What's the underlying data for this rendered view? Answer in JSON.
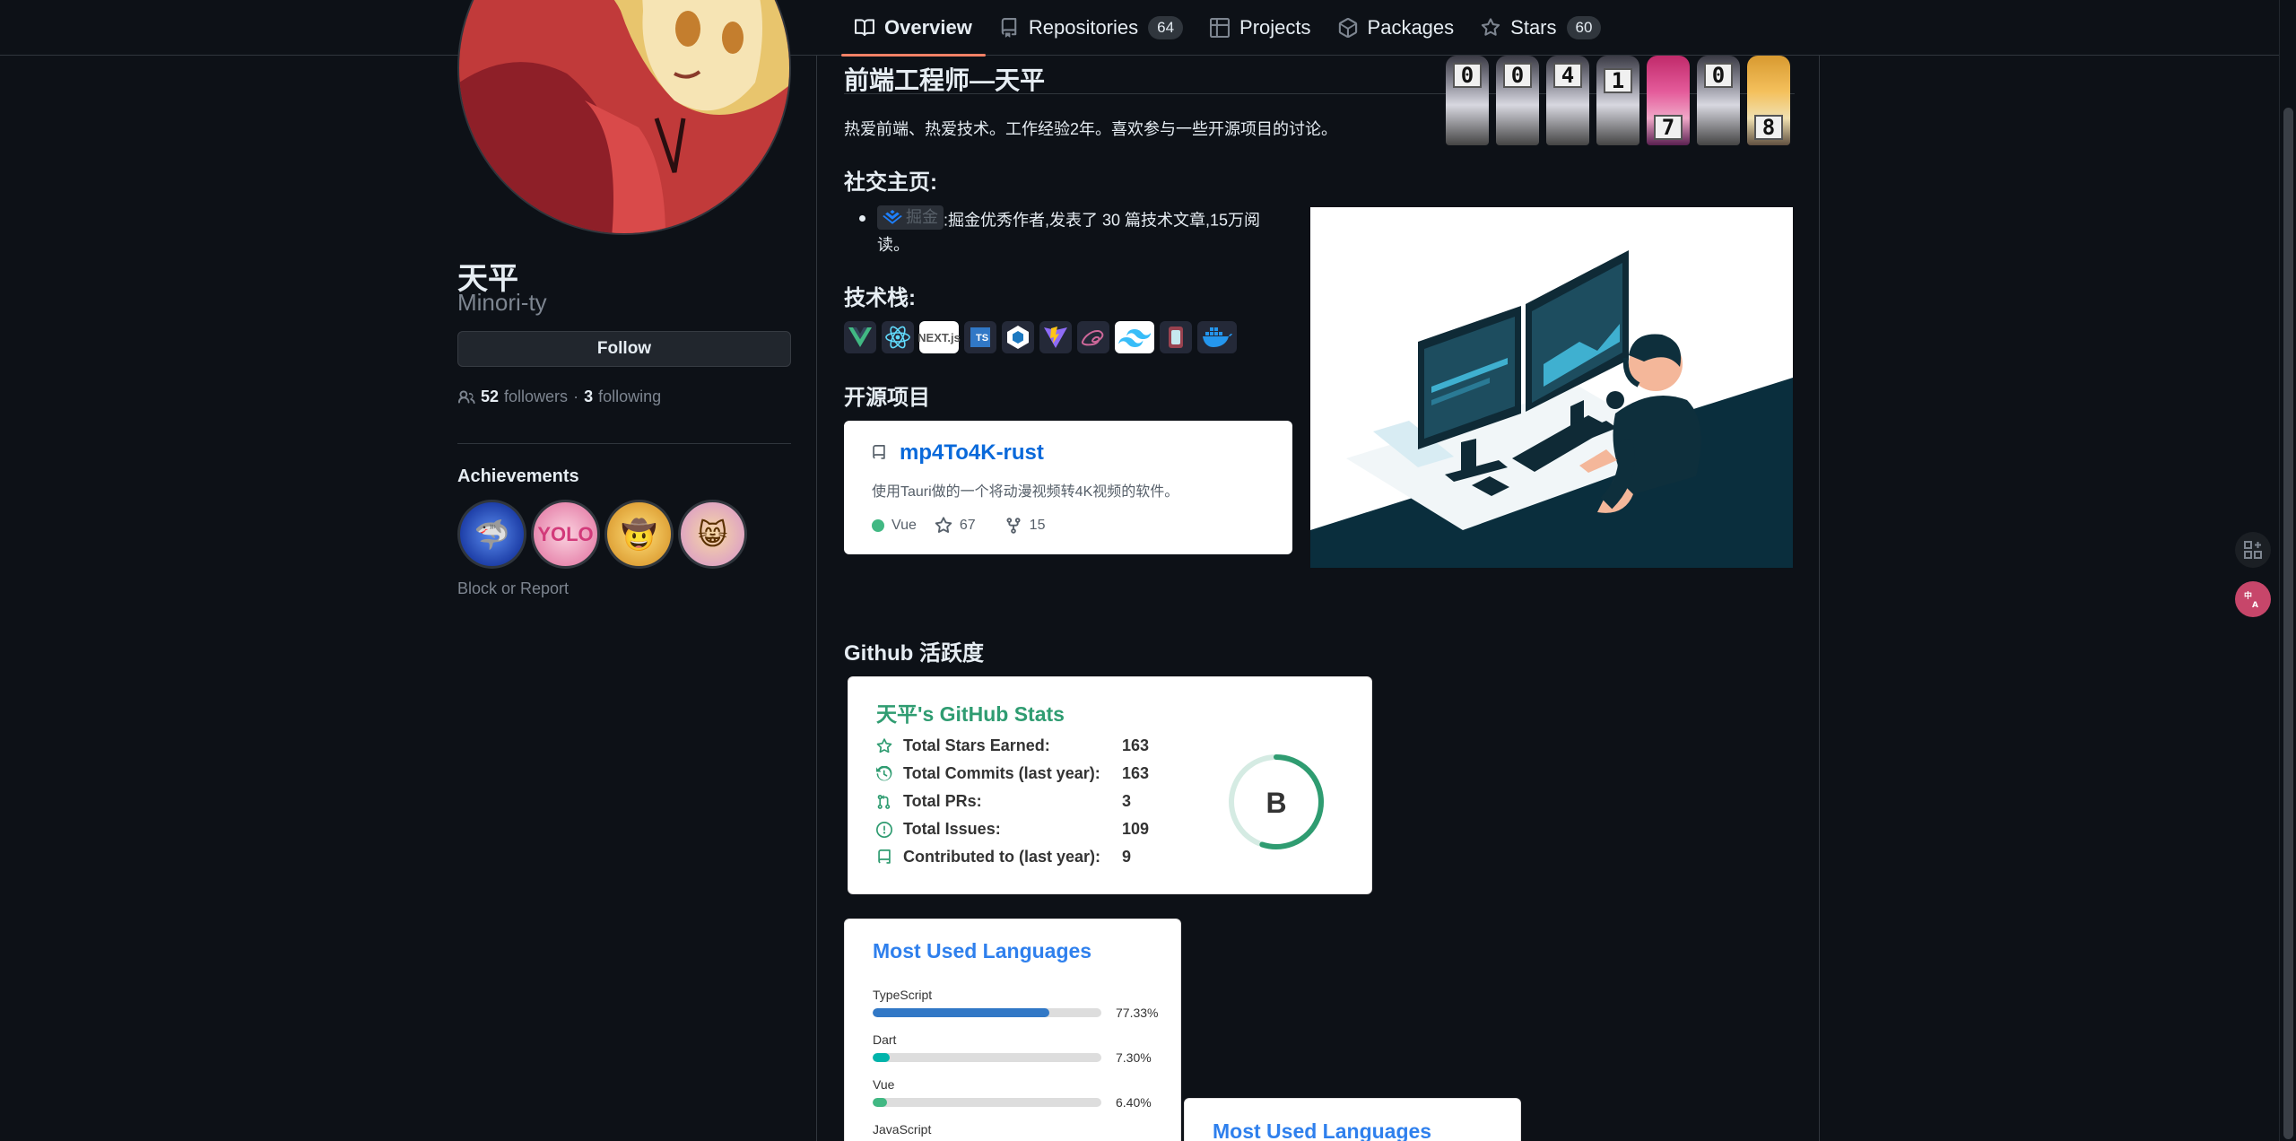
{
  "nav": {
    "tabs": [
      {
        "label": "Overview"
      },
      {
        "label": "Repositories",
        "count": "64"
      },
      {
        "label": "Projects"
      },
      {
        "label": "Packages"
      },
      {
        "label": "Stars",
        "count": "60"
      }
    ]
  },
  "profile": {
    "name": "天平",
    "login": "Minori-ty",
    "follow_label": "Follow",
    "followers_count": "52",
    "followers_label": "followers",
    "following_count": "3",
    "following_label": "following",
    "achievements_title": "Achievements",
    "block_label": "Block or Report"
  },
  "readme": {
    "title": "前端工程师—天平",
    "visitor_digits": [
      "0",
      "0",
      "4",
      "1",
      "7",
      "0",
      "8"
    ],
    "intro": "热爱前端、热爱技术。工作经验2年。喜欢参与一些开源项目的讨论。",
    "social_heading": "社交主页:",
    "juejin_label": "掘金",
    "social_text": ":掘金优秀作者,发表了 30 篇技术文章,15万阅读。",
    "stack_heading": "技术栈:",
    "stack_icons": [
      "vue-icon",
      "react-icon",
      "nextjs-icon",
      "typescript-icon",
      "webpack-icon",
      "vite-icon",
      "sass-icon",
      "tailwind-icon",
      "jest-icon",
      "docker-icon"
    ],
    "nextjs_label": "NEXT.js",
    "ts_label": "TS",
    "opensource_heading": "开源项目",
    "activity_heading": "Github 活跃度"
  },
  "repo": {
    "name": "mp4To4K-rust",
    "description": "使用Tauri做的一个将动漫视频转4K视频的软件。",
    "language": "Vue",
    "language_color": "#41b883",
    "stars": "67",
    "forks": "15"
  },
  "stats": {
    "title": "天平's GitHub Stats",
    "rows": [
      {
        "label": "Total Stars Earned:",
        "value": "163",
        "icon": "star-icon"
      },
      {
        "label": "Total Commits (last year):",
        "value": "163",
        "icon": "history-icon"
      },
      {
        "label": "Total PRs:",
        "value": "3",
        "icon": "pull-request-icon"
      },
      {
        "label": "Total Issues:",
        "value": "109",
        "icon": "issue-icon"
      },
      {
        "label": "Contributed to (last year):",
        "value": "9",
        "icon": "repo-icon"
      }
    ],
    "rank": "B",
    "rank_progress": 0.55,
    "accent": "#2f9c71"
  },
  "languages": {
    "title": "Most Used Languages",
    "items": [
      {
        "name": "TypeScript",
        "percent": "77.33%",
        "fraction": 0.7733,
        "color": "#3178c6"
      },
      {
        "name": "Dart",
        "percent": "7.30%",
        "fraction": 0.073,
        "color": "#00b4ab"
      },
      {
        "name": "Vue",
        "percent": "6.40%",
        "fraction": 0.064,
        "color": "#41b883"
      },
      {
        "name": "JavaScript"
      }
    ]
  },
  "languages2": {
    "title": "Most Used Languages"
  }
}
